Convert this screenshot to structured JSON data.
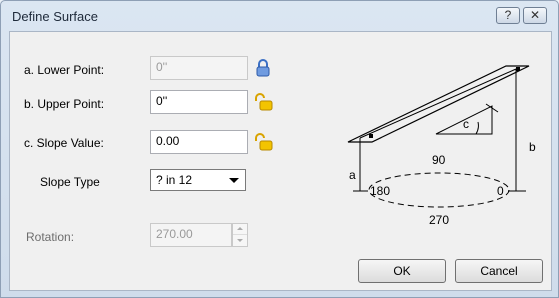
{
  "window": {
    "title": "Define Surface",
    "help_label": "?",
    "close_label": "✕"
  },
  "form": {
    "lower_point": {
      "label": "a. Lower Point:",
      "value": "0''"
    },
    "upper_point": {
      "label": "b. Upper Point:",
      "value": "0''"
    },
    "slope_value": {
      "label": "c. Slope Value:",
      "value": "0.00"
    },
    "slope_type": {
      "label": "Slope Type",
      "value": "? in 12"
    },
    "rotation": {
      "label": "Rotation:",
      "value": "270.00"
    }
  },
  "diagram": {
    "label_a": "a",
    "label_b": "b",
    "label_c": "c",
    "angle_90": "90",
    "angle_180": "180",
    "angle_0": "0",
    "angle_270": "270"
  },
  "buttons": {
    "ok": "OK",
    "cancel": "Cancel"
  },
  "icons": {
    "lock_closed": "lock-closed-icon",
    "lock_open": "lock-open-icon"
  },
  "colors": {
    "lock_closed": "#3a6fc4",
    "lock_open": "#d9a300"
  }
}
